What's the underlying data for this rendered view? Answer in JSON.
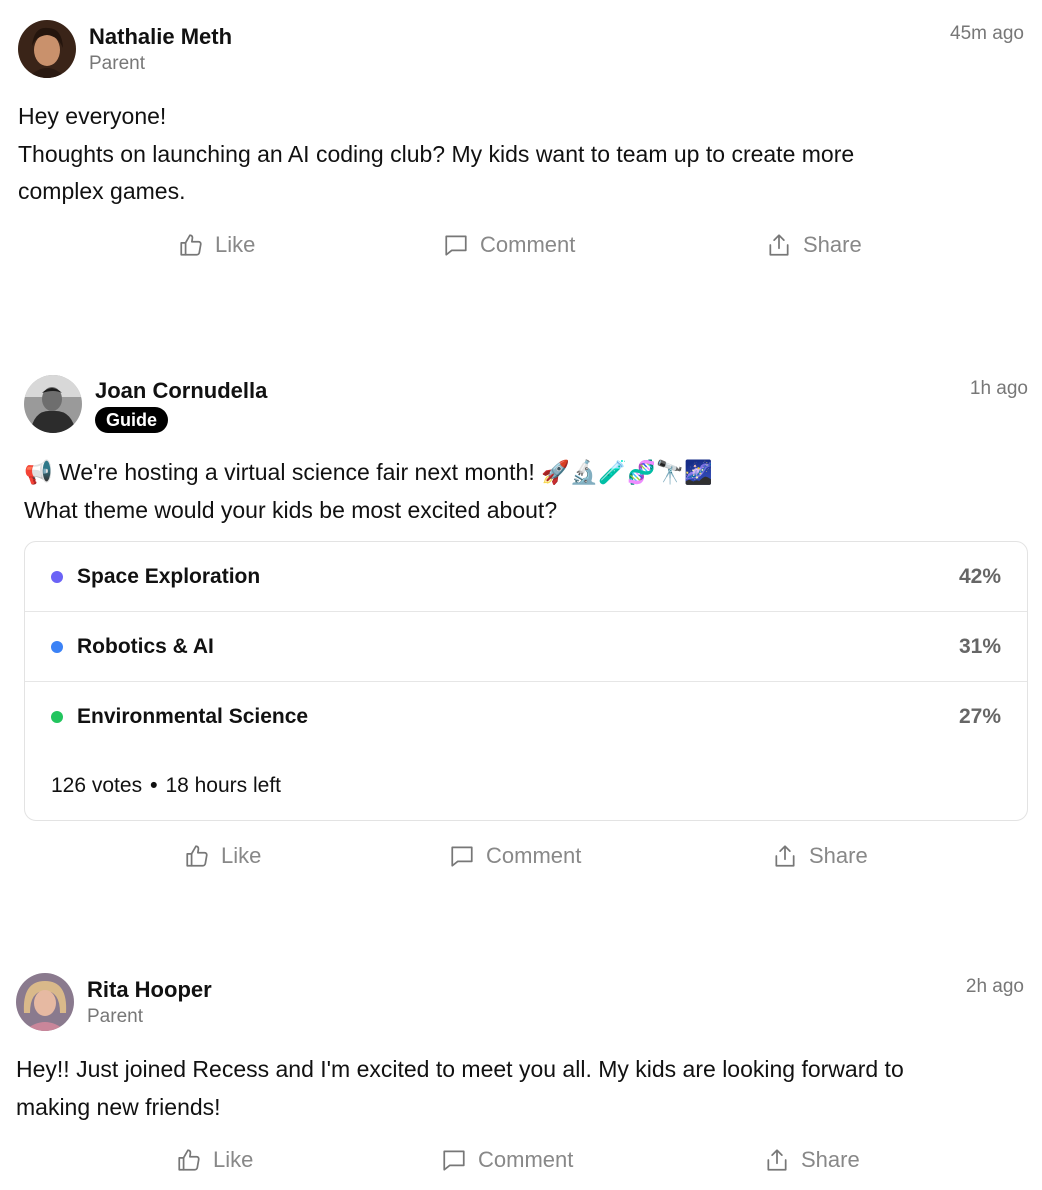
{
  "posts": [
    {
      "author": "Nathalie Meth",
      "role": "Parent",
      "time": "45m ago",
      "body": [
        "Hey everyone!",
        "Thoughts on launching an AI coding club? My kids want to team up to create more",
        "complex games."
      ],
      "actions": {
        "like": "Like",
        "comment": "Comment",
        "share": "Share"
      }
    },
    {
      "author": "Joan Cornudella",
      "role_badge": "Guide",
      "time": "1h ago",
      "body": [
        "📢 We're hosting a virtual science fair next month! 🚀🔬🧪🧬🔭🌌",
        "What theme would your kids be most excited about?"
      ],
      "poll": {
        "options": [
          {
            "label": "Space Exploration",
            "percent": "42%",
            "color": "#6b63f6"
          },
          {
            "label": "Robotics & AI",
            "percent": "31%",
            "color": "#3b82f6"
          },
          {
            "label": "Environmental Science",
            "percent": "27%",
            "color": "#22c55e"
          }
        ],
        "votes": "126 votes",
        "separator": "•",
        "time_left": "18 hours left"
      },
      "actions": {
        "like": "Like",
        "comment": "Comment",
        "share": "Share"
      }
    },
    {
      "author": "Rita Hooper",
      "role": "Parent",
      "time": "2h ago",
      "body": [
        "Hey!! Just joined Recess and I'm excited to meet you all. My kids are looking forward to",
        "making new friends!"
      ],
      "actions": {
        "like": "Like",
        "comment": "Comment",
        "share": "Share"
      }
    }
  ],
  "icons": {
    "like": "thumbs-up-icon",
    "comment": "speech-bubble-icon",
    "share": "share-upload-icon"
  },
  "colors": {
    "muted_text": "#777777",
    "action_text": "#888888",
    "badge_bg": "#000000"
  }
}
